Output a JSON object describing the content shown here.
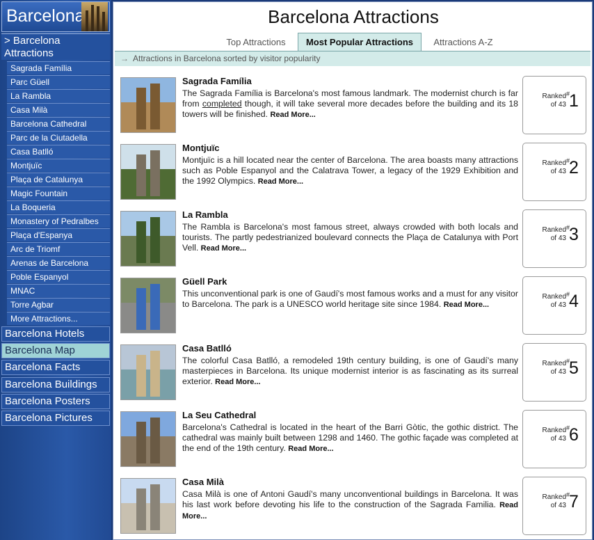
{
  "sidebar": {
    "logo_text": "Barcelona",
    "section_header": "> Barcelona Attractions",
    "attractions": [
      "Sagrada Família",
      "Parc Güell",
      "La Rambla",
      "Casa Milà",
      "Barcelona Cathedral",
      "Parc de la Ciutadella",
      "Casa Batlló",
      "Montjuïc",
      "Plaça de Catalunya",
      "Magic Fountain",
      "La Boqueria",
      "Monastery of Pedralbes",
      "Plaça d'Espanya",
      "Arc de Triomf",
      "Arenas de Barcelona",
      "Poble Espanyol",
      "MNAC",
      "Torre Agbar",
      "More Attractions..."
    ],
    "nav": [
      "Barcelona Hotels",
      "Barcelona Map",
      "Barcelona Facts",
      "Barcelona Buildings",
      "Barcelona Posters",
      "Barcelona Pictures"
    ],
    "active_nav": "Barcelona Map"
  },
  "main": {
    "title": "Barcelona Attractions",
    "tabs": [
      "Top Attractions",
      "Most Popular Attractions",
      "Attractions A-Z"
    ],
    "active_tab": "Most Popular Attractions",
    "subheader": "Attractions in Barcelona sorted by visitor popularity",
    "read_more": "Read More...",
    "rank_prefix": "Ranked",
    "rank_of": "of 43",
    "rank_hash": "#",
    "cards": [
      {
        "title": "Sagrada Família",
        "text_before": "The Sagrada Família is Barcelona's most famous landmark. The modernist church is far from ",
        "link_word": "completed",
        "text_after": " though, it will take several more decades before the building and its 18 towers will be finished.",
        "rank": "1"
      },
      {
        "title": "Montjuïc",
        "text_before": "Montjuïc is a hill located near the center of Barcelona. The area boasts many attractions such as Poble Espanyol and the Calatrava Tower, a legacy of the 1929 Exhibition and the 1992 Olympics.",
        "link_word": "",
        "text_after": "",
        "rank": "2"
      },
      {
        "title": "La Rambla",
        "text_before": "The Rambla is Barcelona's most famous street, always crowded with both locals and tourists. The partly pedestrianized boulevard connects the Plaça de Catalunya with Port Vell.",
        "link_word": "",
        "text_after": "",
        "rank": "3"
      },
      {
        "title": "Güell Park",
        "text_before": "This unconventional park is one of Gaudí's most famous works and a must for any visitor to Barcelona. The park is a UNESCO world heritage site since 1984.",
        "link_word": "",
        "text_after": "",
        "rank": "4"
      },
      {
        "title": "Casa Batlló",
        "text_before": "The colorful Casa Batlló, a remodeled 19th century building, is one of Gaudí's many masterpieces in Barcelona. Its unique modernist interior is as fascinating as its surreal exterior.",
        "link_word": "",
        "text_after": "",
        "rank": "5"
      },
      {
        "title": "La Seu Cathedral",
        "text_before": "Barcelona's Cathedral is located in the heart of the Barri Gòtic, the gothic district. The cathedral was mainly built between 1298 and 1460. The gothic façade was completed at the end of the 19th century.",
        "link_word": "",
        "text_after": "",
        "rank": "6"
      },
      {
        "title": "Casa Milà",
        "text_before": "Casa Milà is one of Antoni Gaudí's many unconventional buildings in Barcelona. It was his last work before devoting his life to the construction of the Sagrada Familia.",
        "link_word": "",
        "text_after": "",
        "rank": "7"
      }
    ]
  }
}
